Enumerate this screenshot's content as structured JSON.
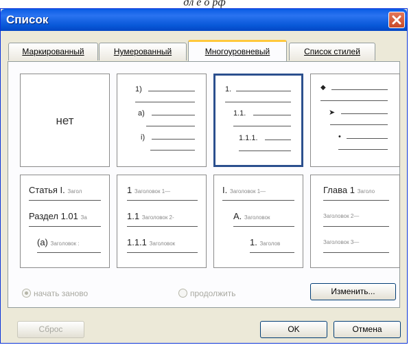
{
  "window": {
    "title": "Список"
  },
  "tabs": [
    {
      "label": "Маркированный"
    },
    {
      "label": "Нумерованный"
    },
    {
      "label": "Многоуровневый"
    },
    {
      "label": "Список стилей"
    }
  ],
  "selected_tab": "Многоуровневый",
  "list_cards": {
    "none": {
      "label": "нет"
    },
    "numbered_paren": {
      "l1": "1)",
      "l2": "а)",
      "l3": "i)"
    },
    "decimal": {
      "l1": "1.",
      "l2": "1.1.",
      "l3": "1.1.1."
    },
    "bullets": {
      "l1": "◆",
      "l2": "➤",
      "l3": "•"
    },
    "articles": {
      "l1": "Статья I.",
      "l1_text": "Загол",
      "l2": "Раздел 1.01",
      "l2_text": "За",
      "l3": "(a)",
      "l3_text": "Заголовок :"
    },
    "headings_decimal": {
      "l1": "1",
      "l1_text": "Заголовок 1—",
      "l2": "1.1",
      "l2_text": "Заголовок 2-",
      "l3": "1.1.1",
      "l3_text": "Заголовок"
    },
    "roman": {
      "l1": "I.",
      "l1_text": "Заголовок 1—",
      "l2": "A.",
      "l2_text": "Заголовок",
      "l3": "1.",
      "l3_text": "Заголов"
    },
    "chapter": {
      "l1": "Глава 1",
      "l1_text": "Заголо",
      "l2_text": "Заголовок 2—",
      "l3_text": "Заголовок 3—"
    }
  },
  "options": {
    "restart_label": "начать заново",
    "continue_label": "продолжить",
    "restart_selected": true
  },
  "buttons": {
    "change": "Изменить...",
    "reset": "Сброс",
    "ok": "OK",
    "cancel": "Отмена"
  },
  "colors": {
    "titlebar": "#0a5ce4",
    "dialog_bg": "#ece9d8",
    "selected_border": "#2b4f8e",
    "active_tab_highlight": "#ffc83c"
  }
}
